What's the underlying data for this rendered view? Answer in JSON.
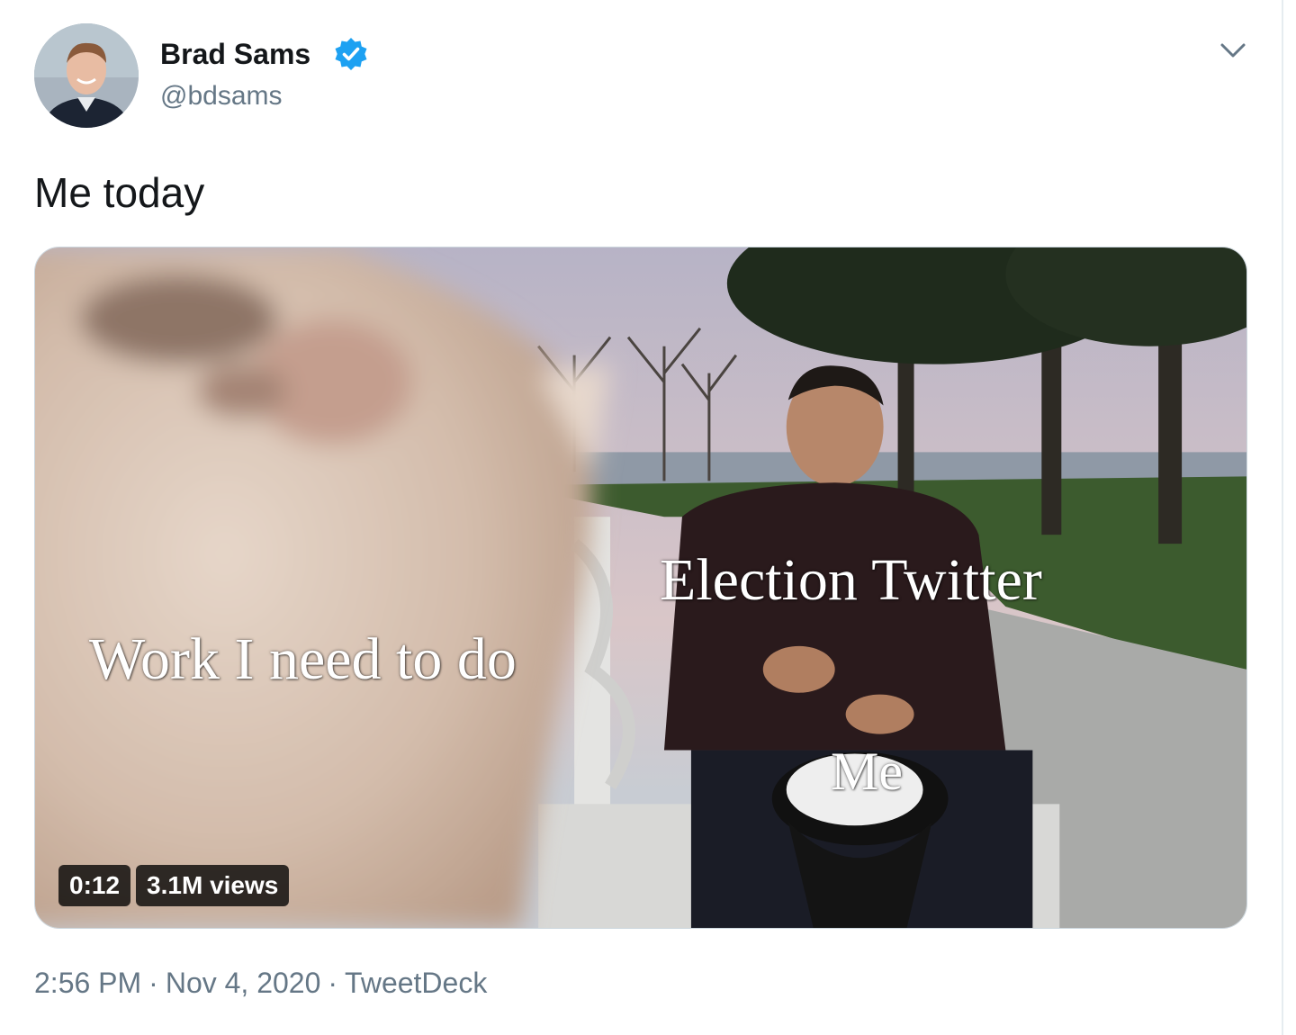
{
  "author": {
    "name": "Brad Sams",
    "handle": "@bdsams",
    "verified": true
  },
  "tweet": {
    "text": "Me today"
  },
  "media": {
    "labels": {
      "work": "Work I need to do",
      "election": "Election Twitter",
      "me": "Me"
    },
    "duration": "0:12",
    "views": "3.1M views"
  },
  "meta": {
    "time": "2:56 PM",
    "separator": "·",
    "date": "Nov 4, 2020",
    "source": "TweetDeck"
  },
  "colors": {
    "verified_blue": "#1da1f2",
    "secondary_text": "#657786"
  },
  "icons": {
    "verified": "verified-badge-icon",
    "menu": "chevron-down-icon"
  }
}
